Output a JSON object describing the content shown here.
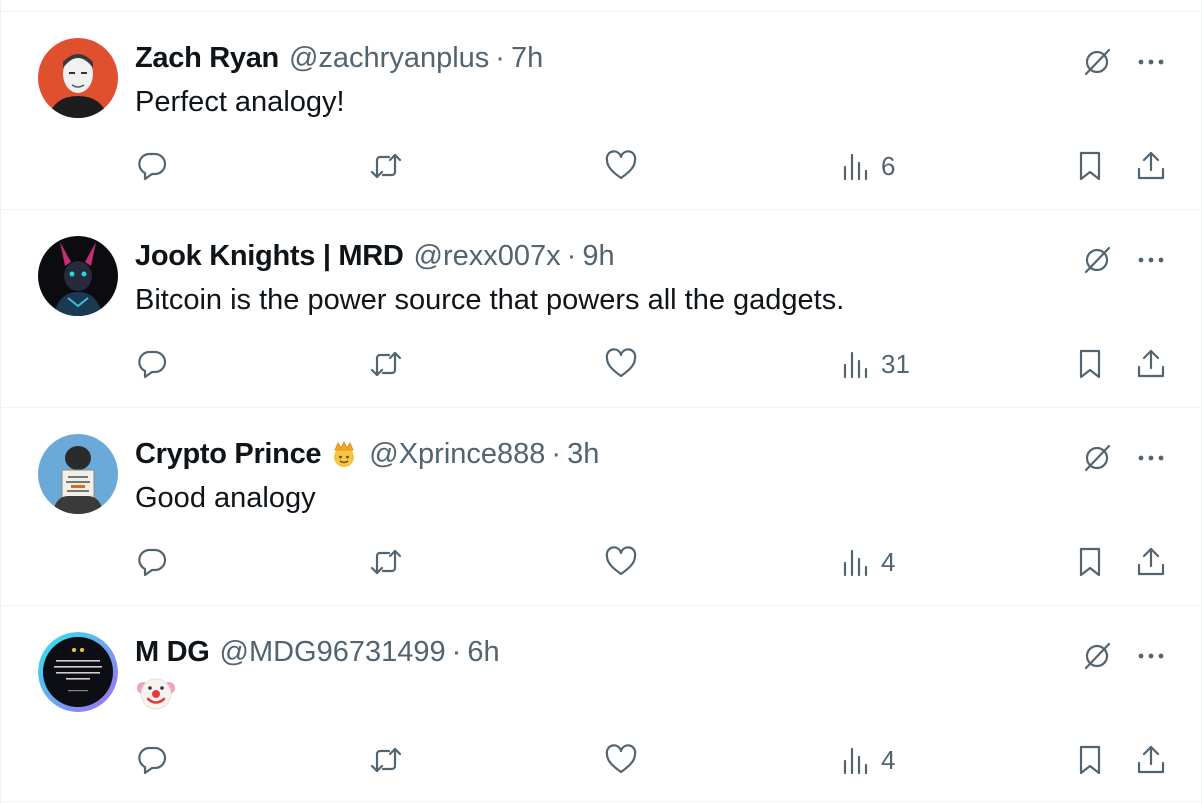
{
  "tweets": [
    {
      "name": "Zach Ryan",
      "handle": "@zachryanplus",
      "separator": "·",
      "time": "7h",
      "text": "Perfect analogy!",
      "views": "6",
      "avatar_bg": "#e0502f"
    },
    {
      "name": "Jook Knights | MRD",
      "handle": "@rexx007x",
      "separator": "·",
      "time": "9h",
      "text": "Bitcoin is the power source that powers all the gadgets.",
      "views": "31",
      "avatar_bg": "#0b0b10"
    },
    {
      "name": "Crypto Prince",
      "handle": "@Xprince888",
      "separator": "·",
      "time": "3h",
      "text": "Good analogy",
      "views": "4",
      "name_badge": "prince-emoji-icon",
      "avatar_bg": "#6aa9d8"
    },
    {
      "name": "M DG",
      "handle": "@MDG96731499",
      "separator": "·",
      "time": "6h",
      "text": "",
      "text_emoji": "clown-face-emoji-icon",
      "views": "4",
      "avatar_bg": "#0d0d14"
    }
  ],
  "icons": {
    "reply": "reply-icon",
    "retweet": "retweet-icon",
    "like": "heart-icon",
    "views": "views-chart-icon",
    "bookmark": "bookmark-icon",
    "share": "share-icon",
    "grok": "grok-icon",
    "more": "more-dots-icon"
  },
  "colors": {
    "text_primary": "#0f1419",
    "text_secondary": "#536471",
    "divider": "#eff3f4"
  }
}
